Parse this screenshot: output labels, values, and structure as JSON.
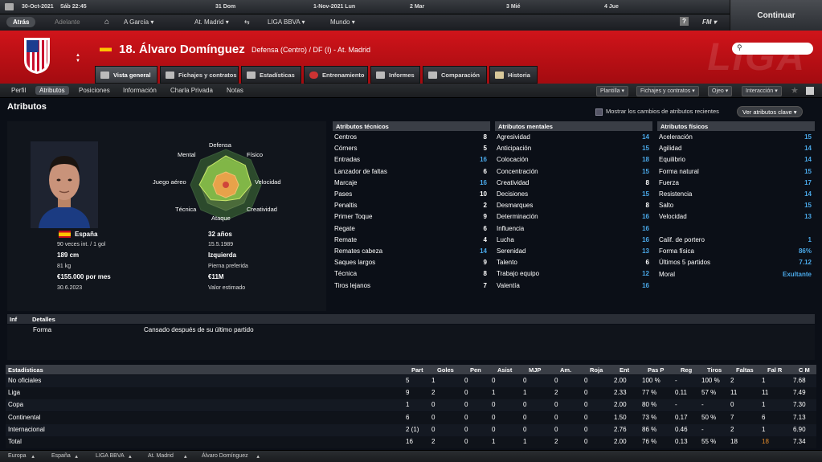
{
  "calendar": {
    "date": "30-Oct-2021",
    "day_time": "Sáb 22:45",
    "days": [
      "31 Dom",
      "1-Nov-2021 Lun",
      "2 Mar",
      "3 Mié",
      "4 Jue"
    ]
  },
  "nav": {
    "back": "Atrás",
    "forward": "Adelante",
    "manager": "A García",
    "club": "At. Madrid",
    "league": "LIGA BBVA",
    "world": "Mundo",
    "fm_label": "FM",
    "help": "?"
  },
  "continue_label": "Continuar",
  "header": {
    "watermark": "LIGA",
    "player_name": "18. Álvaro Domínguez",
    "position": "Defensa (Centro) / DF (I) - At. Madrid"
  },
  "player_tabs": [
    "Vista general",
    "Fichajes y contratos",
    "Estadísticas",
    "Entrenamiento",
    "Informes",
    "Comparación",
    "Historia"
  ],
  "subnav": {
    "items": [
      "Perfil",
      "Atributos",
      "Posiciones",
      "Información",
      "Charla Privada",
      "Notas"
    ],
    "active": "Atributos",
    "right_buttons": [
      "Plantilla",
      "Fichajes y contratos",
      "Ojeo",
      "Interacción"
    ]
  },
  "section_title": "Atributos",
  "show_changes_label": "Mostrar los cambios de atributos recientes",
  "key_attributes_button": "Ver atributos clave",
  "radar_labels": {
    "top": "Defensa",
    "top_right": "Físico",
    "right": "Velocidad",
    "bottom_right": "Creatividad",
    "bottom": "Ataque",
    "bottom_left": "Técnica",
    "left": "Juego aéreo",
    "top_left": "Mental"
  },
  "radar_values": [
    0.82,
    0.78,
    0.72,
    0.55,
    0.45,
    0.6,
    0.75,
    0.7
  ],
  "profile": {
    "nationality": "España",
    "caps": "90 veces int. / 1 gol",
    "age": "32 años",
    "birth": "15.5.1989",
    "height": "189 cm",
    "foot": "Izquierda",
    "weight": "81 kg",
    "foot_label": "Pierna preferida",
    "wage": "€155.000 por mes",
    "value": "€11M",
    "contract_end": "30.6.2023",
    "value_label": "Valor estimado"
  },
  "technical": {
    "title": "Atributos técnicos",
    "rows": [
      {
        "n": "Centros",
        "v": "8",
        "hl": false
      },
      {
        "n": "Córners",
        "v": "5",
        "hl": false
      },
      {
        "n": "Entradas",
        "v": "16",
        "hl": true
      },
      {
        "n": "Lanzador de faltas",
        "v": "6",
        "hl": false
      },
      {
        "n": "Marcaje",
        "v": "16",
        "hl": true
      },
      {
        "n": "Pases",
        "v": "10",
        "hl": false
      },
      {
        "n": "Penaltis",
        "v": "2",
        "hl": false
      },
      {
        "n": "Primer Toque",
        "v": "9",
        "hl": false
      },
      {
        "n": "Regate",
        "v": "6",
        "hl": false
      },
      {
        "n": "Remate",
        "v": "4",
        "hl": false
      },
      {
        "n": "Remates cabeza",
        "v": "14",
        "hl": true
      },
      {
        "n": "Saques largos",
        "v": "9",
        "hl": false
      },
      {
        "n": "Técnica",
        "v": "8",
        "hl": false
      },
      {
        "n": "Tiros lejanos",
        "v": "7",
        "hl": false
      }
    ]
  },
  "mental": {
    "title": "Atributos mentales",
    "rows": [
      {
        "n": "Agresividad",
        "v": "14",
        "hl": true
      },
      {
        "n": "Anticipación",
        "v": "15",
        "hl": true
      },
      {
        "n": "Colocación",
        "v": "18",
        "hl": true
      },
      {
        "n": "Concentración",
        "v": "15",
        "hl": true
      },
      {
        "n": "Creatividad",
        "v": "8",
        "hl": false
      },
      {
        "n": "Decisiones",
        "v": "15",
        "hl": true
      },
      {
        "n": "Desmarques",
        "v": "8",
        "hl": false
      },
      {
        "n": "Determinación",
        "v": "16",
        "hl": true
      },
      {
        "n": "Influencia",
        "v": "16",
        "hl": true
      },
      {
        "n": "Lucha",
        "v": "16",
        "hl": true
      },
      {
        "n": "Serenidad",
        "v": "13",
        "hl": true
      },
      {
        "n": "Talento",
        "v": "6",
        "hl": false
      },
      {
        "n": "Trabajo equipo",
        "v": "12",
        "hl": true
      },
      {
        "n": "Valentía",
        "v": "16",
        "hl": true
      }
    ]
  },
  "physical": {
    "title": "Atributos físicos",
    "rows": [
      {
        "n": "Aceleración",
        "v": "15",
        "hl": true
      },
      {
        "n": "Agilidad",
        "v": "14",
        "hl": true
      },
      {
        "n": "Equilibrio",
        "v": "14",
        "hl": true
      },
      {
        "n": "Forma natural",
        "v": "15",
        "hl": true
      },
      {
        "n": "Fuerza",
        "v": "17",
        "hl": true
      },
      {
        "n": "Resistencia",
        "v": "14",
        "hl": true
      },
      {
        "n": "Salto",
        "v": "15",
        "hl": true
      },
      {
        "n": "Velocidad",
        "v": "13",
        "hl": true
      }
    ],
    "extra": [
      {
        "n": "Calif. de portero",
        "v": "1",
        "hl": true
      },
      {
        "n": "Forma física",
        "v": "86%",
        "hl": true
      },
      {
        "n": "Últimos 5 partidos",
        "v": "7.12",
        "hl": true
      },
      {
        "n": "Moral",
        "v": "Exultante",
        "hl": true
      }
    ]
  },
  "details": {
    "col1": "Inf",
    "col2": "Detalles",
    "label": "Forma",
    "text": "Cansado después de su último partido"
  },
  "stats": {
    "title": "Estadísticas",
    "columns": [
      "Part",
      "Goles",
      "Pen",
      "Asist",
      "MJP",
      "Am.",
      "Roja",
      "Ent",
      "Pas P",
      "Reg",
      "Tiros",
      "Faltas",
      "Fal R",
      "C M"
    ],
    "rows": [
      {
        "name": "No oficiales",
        "vals": [
          "5",
          "1",
          "0",
          "0",
          "0",
          "0",
          "0",
          "2.00",
          "100 %",
          "-",
          "100 %",
          "2",
          "1",
          "7.68"
        ]
      },
      {
        "name": "Liga",
        "vals": [
          "9",
          "2",
          "0",
          "1",
          "1",
          "2",
          "0",
          "2.33",
          "77 %",
          "0.11",
          "57 %",
          "11",
          "11",
          "7.49"
        ]
      },
      {
        "name": "Copa",
        "vals": [
          "1",
          "0",
          "0",
          "0",
          "0",
          "0",
          "0",
          "2.00",
          "80 %",
          "-",
          "-",
          "0",
          "1",
          "7.30"
        ]
      },
      {
        "name": "Continental",
        "vals": [
          "6",
          "0",
          "0",
          "0",
          "0",
          "0",
          "0",
          "1.50",
          "73 %",
          "0.17",
          "50 %",
          "7",
          "6",
          "7.13"
        ]
      },
      {
        "name": "Internacional",
        "vals": [
          "2 (1)",
          "0",
          "0",
          "0",
          "0",
          "0",
          "0",
          "2.76",
          "86 %",
          "0.46",
          "-",
          "2",
          "1",
          "6.90"
        ]
      },
      {
        "name": "Total",
        "vals": [
          "16",
          "2",
          "0",
          "1",
          "1",
          "2",
          "0",
          "2.00",
          "76 %",
          "0.13",
          "55 %",
          "18",
          "18",
          "7.34"
        ]
      }
    ]
  },
  "footer": [
    "Europa",
    "España",
    "LIGA BBVA",
    "At. Madrid",
    "Álvaro Domínguez"
  ]
}
